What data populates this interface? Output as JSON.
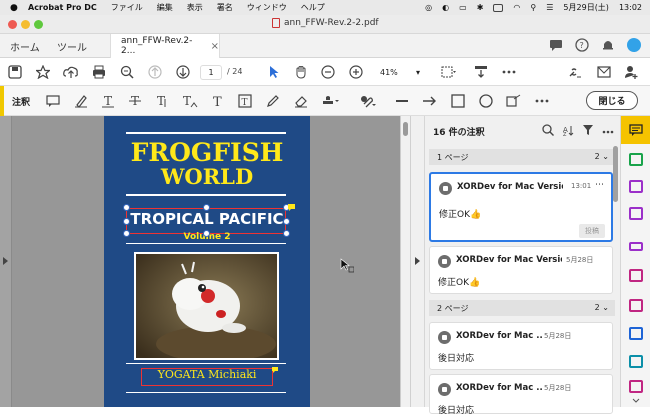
{
  "menubar": {
    "app": "Acrobat Pro DC",
    "items": [
      "ファイル",
      "編集",
      "表示",
      "署名",
      "ウィンドウ",
      "ヘルプ"
    ],
    "date": "5月29日(土)",
    "time": "13:02"
  },
  "window": {
    "title": "ann_FFW-Rev.2-2.pdf"
  },
  "tabs": {
    "home": "ホーム",
    "tools": "ツール",
    "document": "ann_FFW-Rev.2-2..."
  },
  "toolbar": {
    "page_current": "1",
    "page_total": "/ 24",
    "zoom": "41%"
  },
  "annotate_toolbar": {
    "label": "注釈",
    "close": "閉じる"
  },
  "document_page": {
    "title_line1": "FROGFISH",
    "title_line2": "WORLD",
    "subtitle": "TROPICAL PACIFIC",
    "volume": "Volume 2",
    "author": "YOGATA Michiaki"
  },
  "comments_panel": {
    "header": "16 件の注釈",
    "sections": [
      {
        "label": "1 ページ",
        "count": "2"
      },
      {
        "label": "2 ページ",
        "count": "2"
      }
    ],
    "comments": [
      {
        "author": "XORDev for Mac Version",
        "time": "13:01",
        "body": "修正OK👍",
        "post": "投稿"
      },
      {
        "author": "XORDev for Mac Version",
        "time": "5月28日",
        "body": "修正OK👍"
      },
      {
        "author": "XORDev for Mac ...",
        "time": "5月28日",
        "body": "後日対応"
      },
      {
        "author": "XORDev for Mac ...",
        "time": "5月28日",
        "body": "後日対応"
      }
    ]
  },
  "colors": {
    "accent": "#f5c300",
    "selection": "#2d7ae5",
    "page_bg": "#1f4a86",
    "title_yellow": "#ffe81a"
  }
}
